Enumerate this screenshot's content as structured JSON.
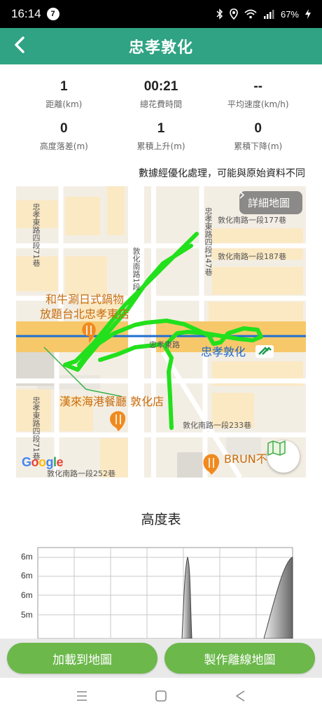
{
  "status_bar": {
    "time": "16:14",
    "badge": "7",
    "battery": "67%"
  },
  "header": {
    "title": "忠孝敦化"
  },
  "stats": {
    "row1": [
      {
        "value": "1",
        "label": "距離(km)"
      },
      {
        "value": "00:21",
        "label": "總花費時間"
      },
      {
        "value": "--",
        "label": "平均速度(km/h)"
      }
    ],
    "row2": [
      {
        "value": "0",
        "label": "高度落差(m)"
      },
      {
        "value": "1",
        "label": "累積上升(m)"
      },
      {
        "value": "0",
        "label": "累積下降(m)"
      }
    ],
    "note": "數據經優化處理，可能與原始資料不同"
  },
  "map": {
    "detail_button": "詳細地圖",
    "streets": {
      "s1": "忠孝東路四段77巷",
      "s2": "敦化南路1段",
      "s3": "忠孝東路四段147巷",
      "s4": "敦化南路一段177巷",
      "s5": "敦化南路一段187巷",
      "s6": "忠孝東路",
      "s7": "敦化南路一段233巷",
      "s8": "忠孝東路四段71巷",
      "s9": "敦化南路一段252巷"
    },
    "pois": {
      "p1_line1": "和牛涮日式鍋物",
      "p1_line2": "放題台北忠孝東店",
      "p2": "漢來海港餐廳 敦化店",
      "p3": "BRUN不"
    },
    "station": "忠孝敦化",
    "google": [
      "G",
      "o",
      "o",
      "g",
      "l",
      "e"
    ],
    "google_colors": [
      "#4285F4",
      "#EA4335",
      "#FBBC05",
      "#4285F4",
      "#34A853",
      "#EA4335"
    ],
    "route_color": "#22e01c"
  },
  "elevation": {
    "title": "高度表",
    "y_ticks": [
      "6m",
      "6m",
      "6m",
      "5m"
    ]
  },
  "buttons": {
    "load": "加載到地圖",
    "offline": "製作離線地圖"
  },
  "colors": {
    "header": "#2fa383",
    "button": "#6cb84b"
  }
}
